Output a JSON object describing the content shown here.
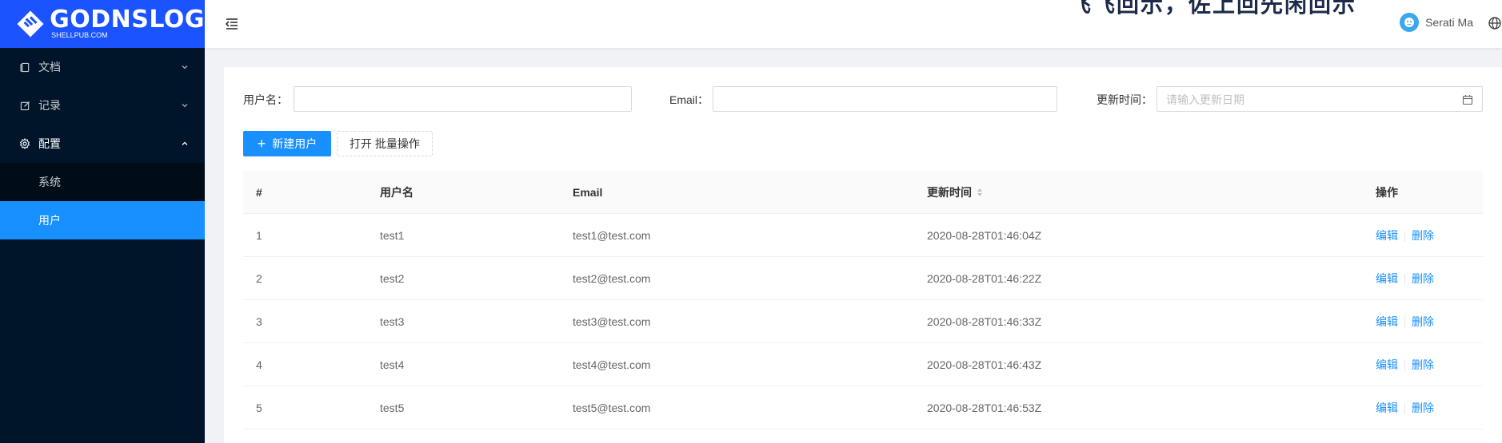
{
  "brand": {
    "name": "GODNSLOG",
    "sub": "SHELLPUB.COM"
  },
  "sidebar": {
    "items": [
      {
        "label": "文档",
        "icon": "file-icon"
      },
      {
        "label": "记录",
        "icon": "edit-icon"
      },
      {
        "label": "配置",
        "icon": "gear-icon"
      }
    ],
    "submenu": [
      {
        "label": "系统"
      },
      {
        "label": "用户"
      }
    ]
  },
  "header": {
    "banner": "飞飞回示，佐上回先闲回示",
    "user_name": "Serati Ma"
  },
  "search": {
    "username_label": "用户名：",
    "email_label": "Email：",
    "time_label": "更新时间：",
    "time_placeholder": "请输入更新日期"
  },
  "actions": {
    "new_user": "新建用户",
    "batch": "打开 批量操作"
  },
  "table": {
    "headers": {
      "num": "#",
      "username": "用户名",
      "email": "Email",
      "updated": "更新时间",
      "ops": "操作"
    },
    "rows": [
      {
        "num": "1",
        "username": "test1",
        "email": "test1@test.com",
        "updated": "2020-08-28T01:46:04Z"
      },
      {
        "num": "2",
        "username": "test2",
        "email": "test2@test.com",
        "updated": "2020-08-28T01:46:22Z"
      },
      {
        "num": "3",
        "username": "test3",
        "email": "test3@test.com",
        "updated": "2020-08-28T01:46:33Z"
      },
      {
        "num": "4",
        "username": "test4",
        "email": "test4@test.com",
        "updated": "2020-08-28T01:46:43Z"
      },
      {
        "num": "5",
        "username": "test5",
        "email": "test5@test.com",
        "updated": "2020-08-28T01:46:53Z"
      }
    ],
    "edit_label": "编辑",
    "delete_label": "删除"
  },
  "colors": {
    "brand": "#1a53ff",
    "sidebar": "#001529",
    "primary": "#1890ff"
  }
}
